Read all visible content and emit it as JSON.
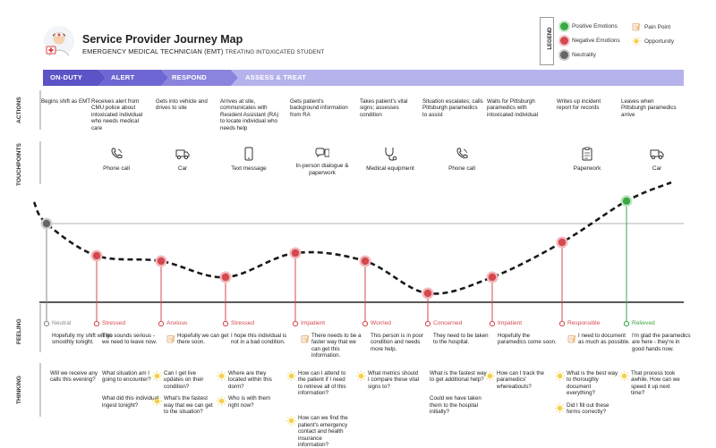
{
  "header": {
    "title": "Service Provider Journey Map",
    "subtitle_main": "EMERGENCY MEDICAL TECHNICIAN (EMT)",
    "subtitle_sub": "TREATING INTOXICATED STUDENT",
    "persona_icon": "paramedic-icon"
  },
  "legend": {
    "title": "LEGEND",
    "items": [
      {
        "label": "Positive Emotions",
        "color": "#39a845",
        "icon": "positive-dot-icon"
      },
      {
        "label": "Negative Emotions",
        "color": "#d4494f",
        "icon": "negative-dot-icon"
      },
      {
        "label": "Neutrality",
        "color": "#666666",
        "icon": "neutral-dot-icon"
      },
      {
        "label": "Pain Point",
        "icon": "pain-point-icon"
      },
      {
        "label": "Opportunity",
        "icon": "lightbulb-icon"
      }
    ]
  },
  "stages": [
    {
      "label": "ON-DUTY",
      "color": "#5b54c7"
    },
    {
      "label": "ALERT",
      "color": "#6e67d3"
    },
    {
      "label": "RESPOND",
      "color": "#8a84de"
    },
    {
      "label": "ASSESS & TREAT",
      "color": "#b6b2ec"
    }
  ],
  "rows": {
    "actions": "ACTIONS",
    "touchpoints": "TOUCHPOINTS",
    "feeling": "FEELING",
    "thinking": "THINKING"
  },
  "actions": [
    "Begins shift as EMT",
    "Receives alert from CMU police about intoxicated individual who needs medical care",
    "Gets into vehicle and drives to site",
    "Arrives at site, communicates with Resident Assistant (RA) to locate individual who needs help",
    "Gets patient's background information from RA",
    "Takes patient's vital signs; assesses condition",
    "Situation escalates; calls Pittsburgh paramedics to assist",
    "Waits for Pittsburgh paramedics with intoxicated individual",
    "Writes up incident report for records",
    "Leaves when Pittsburgh paramedics arrive"
  ],
  "touchpoints": [
    {
      "label": "Phone call",
      "icon": "phone-icon"
    },
    {
      "label": "Car",
      "icon": "truck-icon"
    },
    {
      "label": "Text message",
      "icon": "smartphone-icon"
    },
    {
      "label": "In-person dialogue & paperwork",
      "icon": "chat-clipboard-icon"
    },
    {
      "label": "Medical equipment",
      "icon": "stethoscope-icon"
    },
    {
      "label": "Phone call",
      "icon": "phone-icon"
    },
    {
      "label": "Paperwork",
      "icon": "clipboard-icon"
    },
    {
      "label": "Car",
      "icon": "truck-icon"
    }
  ],
  "feelings": [
    {
      "emotion": "Neutral",
      "type": "neutral",
      "color": "#888888",
      "text": "Hopefully my shift will go smoothly tonight."
    },
    {
      "emotion": "Stressed",
      "type": "negative",
      "color": "#d4494f",
      "text": "This sounds serious - we need to leave now."
    },
    {
      "emotion": "Anxious",
      "type": "negative",
      "color": "#d4494f",
      "text": "Hopefully we can get there soon.",
      "pain": true
    },
    {
      "emotion": "Stressed",
      "type": "negative",
      "color": "#d4494f",
      "text": "I hope this individual is not in a bad condition."
    },
    {
      "emotion": "Impatient",
      "type": "negative",
      "color": "#d4494f",
      "text": "There needs to be a faster way that we can get this information.",
      "pain": true
    },
    {
      "emotion": "Worried",
      "type": "negative",
      "color": "#d4494f",
      "text": "This person is in poor condition and needs more help."
    },
    {
      "emotion": "Concerned",
      "type": "negative",
      "color": "#d4494f",
      "text": "They need to be taken to the hospital."
    },
    {
      "emotion": "Impatient",
      "type": "negative",
      "color": "#d4494f",
      "text": "Hopefully the paramedics come soon."
    },
    {
      "emotion": "Responsible",
      "type": "negative",
      "color": "#d4494f",
      "text": "I need to document as much as possible.",
      "pain": true
    },
    {
      "emotion": "Relieved",
      "type": "positive",
      "color": "#39a845",
      "text": "I'm glad the paramedics are here - they're in good hands now."
    }
  ],
  "thinking": [
    {
      "q": [
        "Will we receive any calls this evening?"
      ]
    },
    {
      "q": [
        "What situation am I going to encounter?",
        "What did this individual ingest tonight?"
      ]
    },
    {
      "q": [
        "Can I get live updates on their condition?",
        "What's the fastest way that we can get to the situation?"
      ],
      "bulb": true
    },
    {
      "q": [
        "Where are they located within this dorm?",
        "Who is with them right now?"
      ],
      "bulb": true
    },
    {
      "q": [
        "How can I attend to the patient if I need to retrieve all of this information?",
        "How can we find the patient's emergency contact and health insurance information?"
      ],
      "bulb": true
    },
    {
      "q": [
        "What metrics should I compare these vital signs to?"
      ],
      "bulb": true
    },
    {
      "q": [
        "What is the fastest way to get additional help?",
        "Could we have taken them to the hospital initially?"
      ]
    },
    {
      "q": [
        "How can I track the paramedics' whereabouts?"
      ],
      "bulb": true
    },
    {
      "q": [
        "What is the best way to thoroughly document everything?",
        "Did I fill out these forms correctly?"
      ],
      "bulb": true
    },
    {
      "q": [
        "That process took awhile. How can we speed it up next time?"
      ],
      "bulb": true
    }
  ],
  "curve": {
    "levels": [
      0.0,
      -0.6,
      -0.7,
      -1.0,
      -0.55,
      -0.7,
      -1.3,
      -1.0,
      -0.35,
      0.42
    ],
    "colors": {
      "line": "#1a1a1a",
      "neutral_line": "#999999",
      "baseline": "#222222"
    }
  }
}
